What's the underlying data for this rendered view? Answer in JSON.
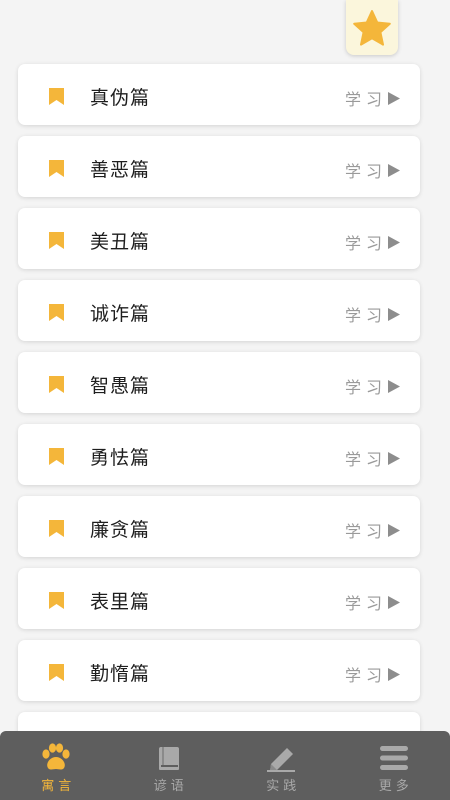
{
  "favorite": {
    "icon": "star-icon",
    "color": "#f4b63a"
  },
  "chapters": [
    {
      "title": "真伪篇",
      "action": "学习"
    },
    {
      "title": "善恶篇",
      "action": "学习"
    },
    {
      "title": "美丑篇",
      "action": "学习"
    },
    {
      "title": "诚诈篇",
      "action": "学习"
    },
    {
      "title": "智愚篇",
      "action": "学习"
    },
    {
      "title": "勇怯篇",
      "action": "学习"
    },
    {
      "title": "廉贪篇",
      "action": "学习"
    },
    {
      "title": "表里篇",
      "action": "学习"
    },
    {
      "title": "勤惰篇",
      "action": "学习"
    }
  ],
  "tabs": [
    {
      "label": "寓言",
      "icon": "paw-icon",
      "active": true
    },
    {
      "label": "谚语",
      "icon": "book-icon",
      "active": false
    },
    {
      "label": "实践",
      "icon": "pencil-icon",
      "active": false
    },
    {
      "label": "更多",
      "icon": "menu-icon",
      "active": false
    }
  ],
  "colors": {
    "accent": "#f4b63a",
    "tab_bar": "#5e5e5e",
    "inactive": "#a9a9a9",
    "background": "#f4f4f4"
  }
}
